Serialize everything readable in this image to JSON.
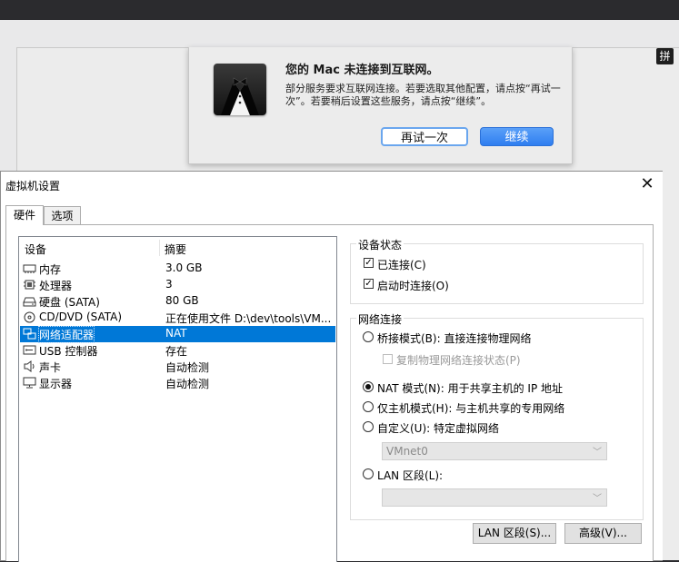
{
  "ime_indicator": "拼",
  "mac_alert": {
    "title": "您的 Mac 未连接到互联网。",
    "message": "部分服务要求互联网连接。若要选取其他配置，请点按“再试一次”。若要稍后设置这些服务，请点按“继续”。",
    "retry_button": "再试一次",
    "continue_button": "继续",
    "icon": "butler-tuxedo-icon",
    "accent_color": "#2f7ef0"
  },
  "dialog": {
    "title": "虚拟机设置",
    "close": "✕",
    "tabs": [
      {
        "label": "硬件",
        "active": true
      },
      {
        "label": "选项",
        "active": false
      }
    ],
    "device_list": {
      "columns": [
        "设备",
        "摘要"
      ],
      "rows": [
        {
          "icon": "memory-icon",
          "device": "内存",
          "summary": "3.0 GB",
          "selected": false
        },
        {
          "icon": "cpu-icon",
          "device": "处理器",
          "summary": "3",
          "selected": false
        },
        {
          "icon": "disk-icon",
          "device": "硬盘 (SATA)",
          "summary": "80 GB",
          "selected": false
        },
        {
          "icon": "cd-icon",
          "device": "CD/DVD (SATA)",
          "summary": "正在使用文件 D:\\dev\\tools\\VM...",
          "selected": false
        },
        {
          "icon": "network-adapter-icon",
          "device": "网络适配器",
          "summary": "NAT",
          "selected": true
        },
        {
          "icon": "usb-icon",
          "device": "USB 控制器",
          "summary": "存在",
          "selected": false
        },
        {
          "icon": "sound-icon",
          "device": "声卡",
          "summary": "自动检测",
          "selected": false
        },
        {
          "icon": "display-icon",
          "device": "显示器",
          "summary": "自动检测",
          "selected": false
        }
      ]
    },
    "device_status": {
      "title": "设备状态",
      "connected": {
        "label": "已连接(C)",
        "checked": true
      },
      "connect_at_power_on": {
        "label": "启动时连接(O)",
        "checked": true
      }
    },
    "network_connection": {
      "title": "网络连接",
      "bridged": {
        "label": "桥接模式(B): 直接连接物理网络",
        "selected": false
      },
      "replicate": {
        "label": "复制物理网络连接状态(P)",
        "checked": false,
        "disabled": true
      },
      "nat": {
        "label": "NAT 模式(N): 用于共享主机的 IP 地址",
        "selected": true
      },
      "host_only": {
        "label": "仅主机模式(H): 与主机共享的专用网络",
        "selected": false
      },
      "custom": {
        "label": "自定义(U): 特定虚拟网络",
        "selected": false
      },
      "custom_network_value": "VMnet0",
      "lan_segment": {
        "label": "LAN 区段(L):",
        "selected": false
      },
      "lan_segment_value": ""
    },
    "buttons": {
      "lan_segments": "LAN 区段(S)...",
      "advanced": "高级(V)..."
    },
    "selection_color": "#0078d7"
  }
}
